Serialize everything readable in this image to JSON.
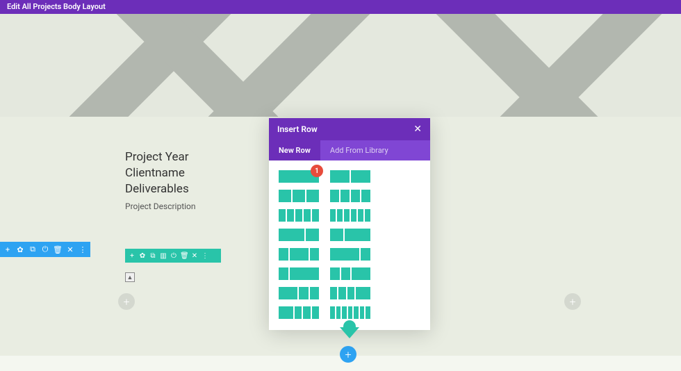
{
  "topbar": {
    "title": "Edit All Projects Body Layout"
  },
  "text": {
    "line1": "Project Year",
    "line2": "Clientname",
    "line3": "Deliverables",
    "desc": "Project Description"
  },
  "modal": {
    "title": "Insert Row",
    "close": "✕",
    "tabs": {
      "new": "New Row",
      "library": "Add From Library"
    },
    "badge": "1",
    "layouts": [
      [
        1
      ],
      [
        1,
        1
      ],
      [
        1,
        1,
        1
      ],
      [
        1,
        1,
        1,
        1
      ],
      [
        1,
        1,
        1,
        1,
        1
      ],
      [
        1,
        1,
        1,
        1,
        1,
        1
      ],
      [
        2,
        1
      ],
      [
        1,
        2
      ],
      [
        1,
        2,
        1
      ],
      [
        3,
        1
      ],
      [
        1,
        3
      ],
      [
        1,
        1,
        2
      ],
      [
        2,
        1,
        1
      ],
      [
        1,
        1,
        1,
        2
      ],
      [
        2,
        1,
        1,
        1
      ],
      [
        1,
        1,
        1,
        1,
        1,
        1,
        1
      ]
    ]
  },
  "icons": {
    "plus": "+",
    "gear": "✿",
    "dup": "⧉",
    "power": "⏻",
    "trash": "🗑",
    "x": "✕",
    "dots": "⋮",
    "cols": "▥"
  }
}
